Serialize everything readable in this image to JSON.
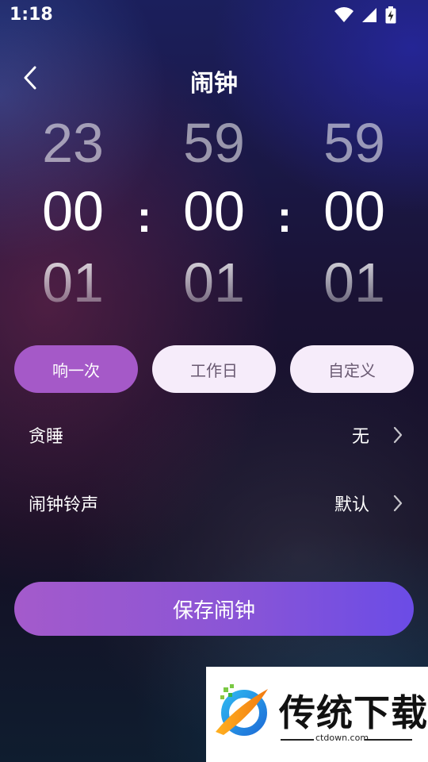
{
  "status_bar": {
    "time": "1:18",
    "icons": [
      "wifi-icon",
      "signal-icon",
      "battery-charging-icon"
    ]
  },
  "header": {
    "title": "闹钟",
    "back_icon": "chevron-left-icon"
  },
  "time_picker": {
    "hours": {
      "prev": "23",
      "current": "00",
      "next": "01"
    },
    "minutes": {
      "prev": "59",
      "current": "00",
      "next": "01"
    },
    "seconds": {
      "prev": "59",
      "current": "00",
      "next": "01"
    },
    "separator": ":"
  },
  "repeat_options": [
    {
      "label": "响一次",
      "selected": true
    },
    {
      "label": "工作日",
      "selected": false
    },
    {
      "label": "自定义",
      "selected": false
    }
  ],
  "settings": [
    {
      "label": "贪睡",
      "value": "无"
    },
    {
      "label": "闹钟铃声",
      "value": "默认"
    }
  ],
  "save_button": {
    "label": "保存闹钟"
  },
  "colors": {
    "accent": "#a559c8",
    "pill_inactive": "#f6ecfa",
    "button_gradient_start": "#a45acb",
    "button_gradient_end": "#6b4ce6"
  },
  "watermark": {
    "brand": "传统下载",
    "site": "ctdown.com"
  }
}
